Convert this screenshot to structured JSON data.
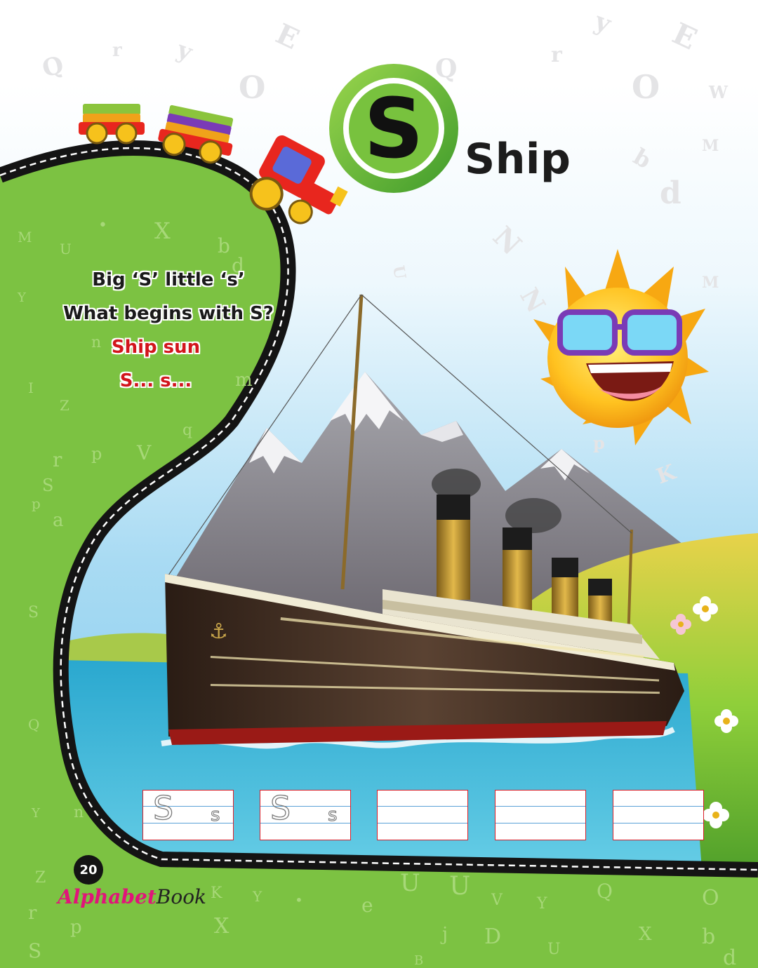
{
  "heading": {
    "letter": "S",
    "word": "Ship"
  },
  "rhyme": {
    "line1": "Big ‘S’ little ‘s’",
    "line2": "What begins with S?",
    "line3": "Ship  sun",
    "line4": "S...  s..."
  },
  "tracing": {
    "guide_upper": "S",
    "guide_lower": "s",
    "boxes_total": 5,
    "boxes_with_guides": 2
  },
  "footer": {
    "page_number": "20",
    "brand_part1": "Alphabet",
    "brand_part2": "Book"
  },
  "colors": {
    "green": "#7cc242",
    "sky": "#bfe4f6",
    "water": "#3fb8d8",
    "accent_red": "#d2151c",
    "brand_pink": "#e0157a"
  },
  "illustrations": [
    "toy-train",
    "ship",
    "mountains",
    "sunglasses-sun",
    "meadow",
    "flowers"
  ]
}
